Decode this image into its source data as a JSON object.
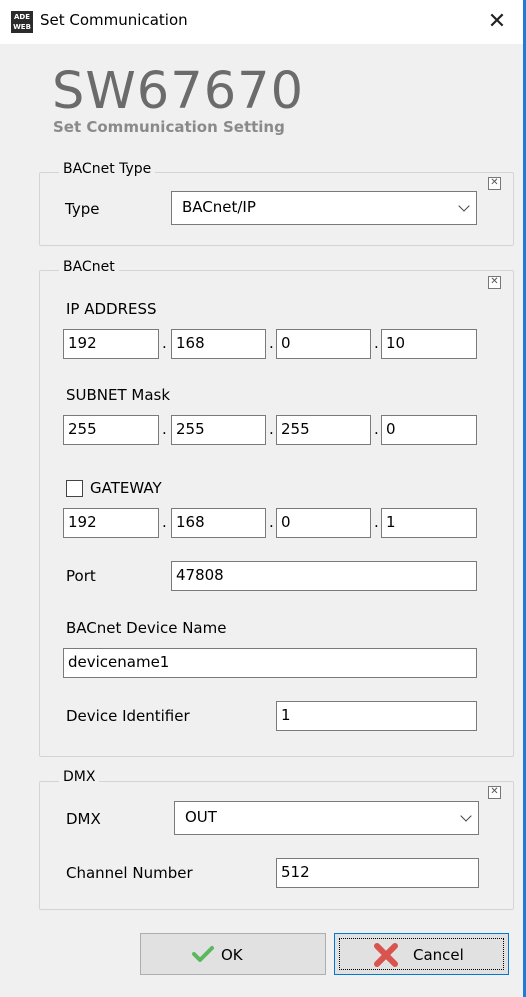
{
  "window": {
    "title": "Set Communication",
    "icon_text": "ADE\nWEB",
    "close_glyph": "✕"
  },
  "header": {
    "brand": "SW67670",
    "subtitle": "Set Communication Setting"
  },
  "bacnet_type": {
    "legend": "BACnet Type",
    "type_label": "Type",
    "type_value": "BACnet/IP"
  },
  "bacnet": {
    "legend": "BACnet",
    "ip_label": "IP ADDRESS",
    "ip": [
      "192",
      "168",
      "0",
      "10"
    ],
    "subnet_label": "SUBNET Mask",
    "subnet": [
      "255",
      "255",
      "255",
      "0"
    ],
    "gateway_label": "GATEWAY",
    "gateway_checked": false,
    "gateway": [
      "192",
      "168",
      "0",
      "1"
    ],
    "port_label": "Port",
    "port_value": "47808",
    "device_name_label": "BACnet Device Name",
    "device_name_value": "devicename1",
    "device_id_label": "Device Identifier",
    "device_id_value": "1"
  },
  "dmx": {
    "legend": "DMX",
    "dmx_label": "DMX",
    "dmx_value": "OUT",
    "channel_label": "Channel Number",
    "channel_value": "512"
  },
  "buttons": {
    "ok_label": "OK",
    "cancel_label": "Cancel"
  },
  "colors": {
    "title_accent": "#1f7bd8",
    "ok_check": "#5cb85c",
    "cancel_x": "#d9534f"
  }
}
